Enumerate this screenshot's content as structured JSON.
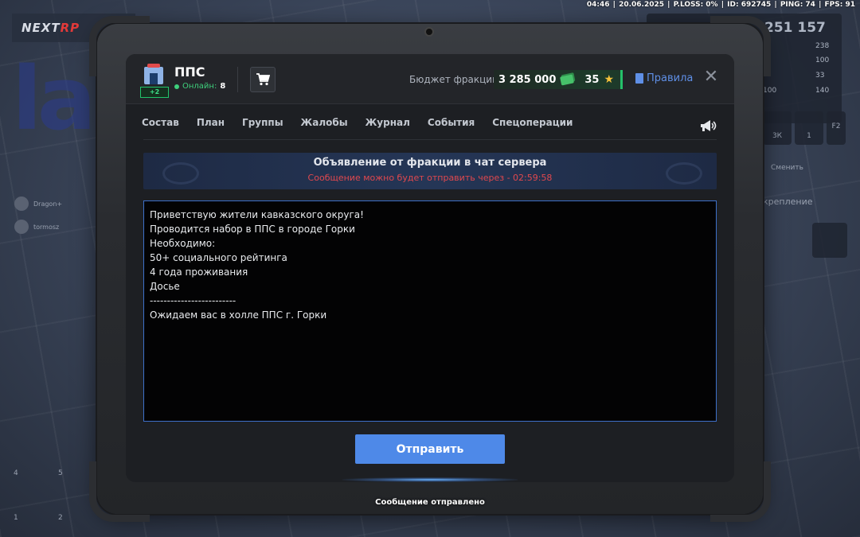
{
  "topbar": {
    "time": "04:46",
    "date": "20.06.2025",
    "ploss": "P.LOSS: 0%",
    "id": "ID: 692745",
    "ping": "PING: 74",
    "fps": "FPS: 91"
  },
  "background_hud": {
    "logo_left": "NEXT",
    "logo_right": "RP",
    "money": "251 157",
    "stats": [
      "238",
      "100",
      "33",
      "140"
    ],
    "stat_left": "100",
    "inv_values": [
      "3К",
      "1"
    ],
    "key_hint": "F2",
    "switch_label": "Сменить",
    "fix_label": "креплениe",
    "users": [
      "Dragon+",
      "tormosz"
    ],
    "slot_numbers": [
      "4",
      "5",
      "1",
      "2"
    ]
  },
  "header": {
    "faction_name": "ППС",
    "faction_badge": "+2",
    "online_label": "Онлайн:",
    "online_count": "8",
    "budget_label": "Бюджет фракции:",
    "budget_amount": "3 285 000",
    "stars": "35",
    "rules_label": "Правила",
    "close": "✕"
  },
  "tabs": [
    "Состав",
    "План",
    "Группы",
    "Жалобы",
    "Журнал",
    "События",
    "Спецоперации"
  ],
  "banner": {
    "title": "Объявление от фракции в чат сервера",
    "timer_text": "Сообщение можно будет отправить через - 02:59:58"
  },
  "message_lines": [
    "Приветствую жители кавказского округа!",
    "Проводится набор в ППС в городе Горки",
    "Необходимо:",
    "50+ социального рейтинга",
    "4 года проживания",
    "Досье",
    "-------------------------",
    "Ожидаем вас в холле ППС г. Горки"
  ],
  "send_button": "Отправить",
  "toast": "Сообщение отправлено",
  "colors": {
    "accent_blue": "#4e89e8",
    "timer_red": "#e0484e",
    "online_green": "#3ed07c",
    "budget_green": "#25c06a",
    "star_gold": "#f5c13b"
  }
}
